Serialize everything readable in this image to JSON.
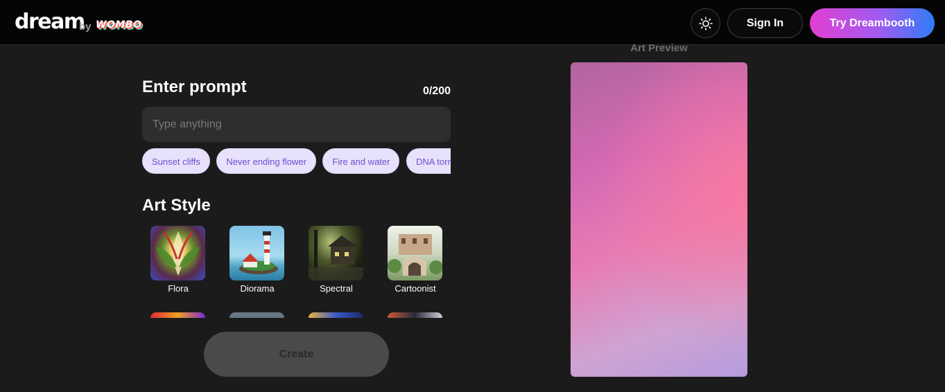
{
  "header": {
    "logo": "dream",
    "by": "by",
    "brand": "WOMBO",
    "sign_in": "Sign In",
    "try_dreambooth": "Try Dreambooth",
    "accent_gradient": [
      "#e33fd1",
      "#2f7cf6"
    ]
  },
  "prompt": {
    "title": "Enter prompt",
    "counter": "0/200",
    "placeholder": "Type anything",
    "value": "",
    "suggestions": [
      "Sunset cliffs",
      "Never ending flower",
      "Fire and water",
      "DNA tornado"
    ]
  },
  "art_style": {
    "title": "Art Style",
    "styles": [
      "Flora",
      "Diorama",
      "Spectral",
      "Cartoonist"
    ]
  },
  "create_label": "Create",
  "preview": {
    "label": "Art Preview"
  }
}
